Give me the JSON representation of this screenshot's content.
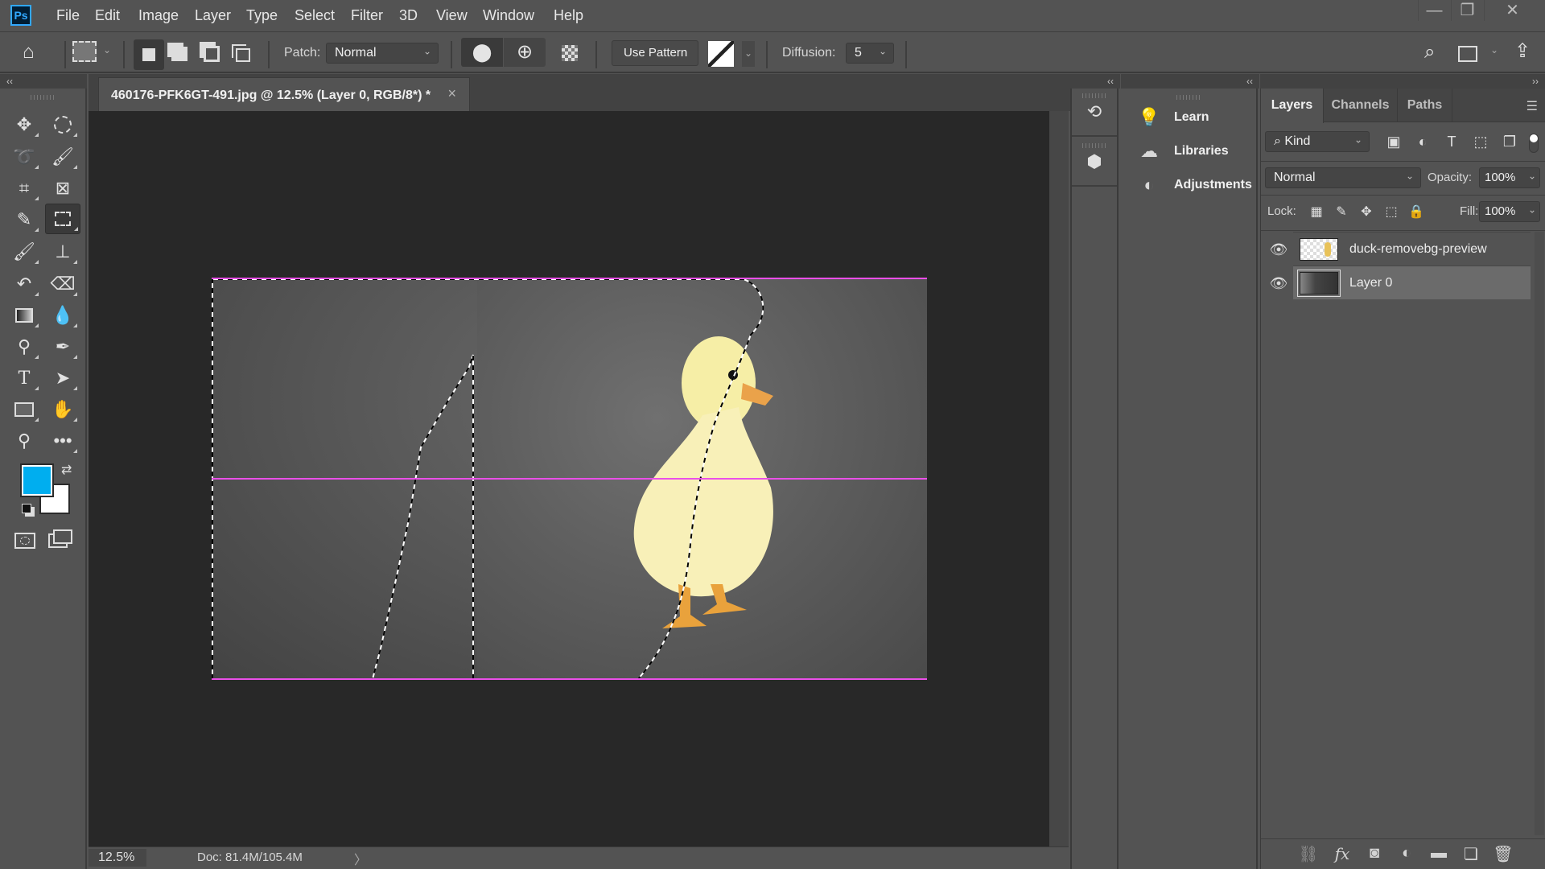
{
  "app": {
    "logo": "Ps"
  },
  "menu": [
    "File",
    "Edit",
    "Image",
    "Layer",
    "Type",
    "Select",
    "Filter",
    "3D",
    "View",
    "Window",
    "Help"
  ],
  "window_controls": {
    "minimize": "—",
    "restore": "❐",
    "close": "✕"
  },
  "options_bar": {
    "home_icon": "home-icon",
    "tool_preset_icon": "patch-tool-icon",
    "selection_modes": [
      "new-selection",
      "add-to-selection",
      "subtract-from-selection",
      "intersect-with-selection"
    ],
    "patch_label": "Patch:",
    "patch_mode": "Normal",
    "source_icon": "source-pin-icon",
    "destination_icon": "destination-target-icon",
    "transparent_icon": "transparent-checker-icon",
    "use_pattern_label": "Use Pattern",
    "diffusion_label": "Diffusion:",
    "diffusion_value": "5"
  },
  "document": {
    "tab_title": "460176-PFK6GT-491.jpg @ 12.5% (Layer 0, RGB/8*) *",
    "close": "×",
    "zoom": "12.5%",
    "doc_info": "Doc: 81.4M/105.4M",
    "info_arrow": "〉"
  },
  "colors": {
    "foreground": "#00aeef",
    "background": "#ffffff",
    "guide": "#ea4fe8",
    "canvas_bg": "#282828"
  },
  "dock": {
    "collapse": "‹‹",
    "buttons": [
      "history-icon",
      "3d-icon"
    ]
  },
  "learn_panel": {
    "collapse": "‹‹",
    "items": [
      {
        "label": "Learn",
        "icon": "lightbulb-icon"
      },
      {
        "label": "Libraries",
        "icon": "cc-libraries-icon"
      },
      {
        "label": "Adjustments",
        "icon": "adjustments-icon"
      }
    ]
  },
  "layers_panel": {
    "collapse": "››",
    "tabs": [
      "Layers",
      "Channels",
      "Paths"
    ],
    "active_tab": "Layers",
    "filter_kind": "Kind",
    "blend_mode": "Normal",
    "opacity_label": "Opacity:",
    "opacity_value": "100%",
    "lock_label": "Lock:",
    "fill_label": "Fill:",
    "fill_value": "100%",
    "layers": [
      {
        "name": "duck-removebg-preview",
        "visible": true,
        "selected": false
      },
      {
        "name": "Layer 0",
        "visible": true,
        "selected": true
      }
    ]
  }
}
